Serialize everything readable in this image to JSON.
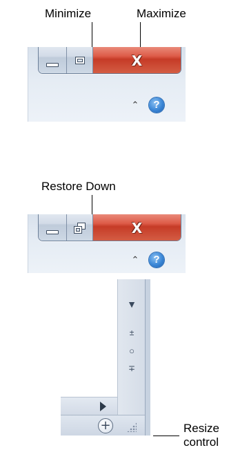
{
  "callouts": {
    "minimize": "Minimize",
    "maximize": "Maximize",
    "restore_down": "Restore Down",
    "resize_line1": "Resize",
    "resize_line2": "control"
  },
  "controls": {
    "close_glyph": "X",
    "help_glyph": "?",
    "ribbon_collapse_glyph": "⌃"
  },
  "scrollbar": {
    "down_glyph": "▼",
    "prev_glyph": "±",
    "browse_glyph": "○",
    "next_glyph": "∓",
    "zoom_in_glyph": "+"
  },
  "colors": {
    "close_red": "#d9523e",
    "chrome_blue": "#d8e1ec",
    "help_blue": "#3a86d6"
  },
  "icons": [
    "minimize-icon",
    "maximize-icon",
    "restore-down-icon",
    "close-icon",
    "ribbon-minimize-icon",
    "help-icon",
    "scroll-down-icon",
    "previous-page-icon",
    "select-browse-object-icon",
    "next-page-icon",
    "scroll-right-icon",
    "zoom-in-icon",
    "resize-grip-icon"
  ]
}
